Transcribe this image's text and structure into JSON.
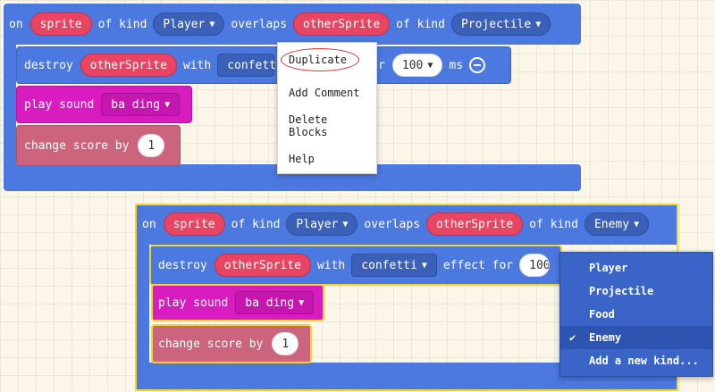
{
  "block1": {
    "on": "on",
    "sprite": "sprite",
    "of_kind": "of kind",
    "kind1": "Player",
    "overlaps": "overlaps",
    "other": "otherSprite",
    "of_kind2": "of kind",
    "kind2": "Projectile",
    "destroy": "destroy",
    "destroy_target": "otherSprite",
    "with": "with",
    "effect": "confett",
    "for_text": "or",
    "duration": "100",
    "ms": "ms",
    "play_sound": "play sound",
    "sound": "ba ding",
    "change_score": "change score by",
    "score": "1"
  },
  "context_menu": {
    "items": [
      "Duplicate",
      "Add Comment",
      "Delete Blocks",
      "Help"
    ]
  },
  "block2": {
    "on": "on",
    "sprite": "sprite",
    "of_kind": "of kind",
    "kind1": "Player",
    "overlaps": "overlaps",
    "other": "otherSprite",
    "of_kind2": "of kind",
    "kind2": "Enemy",
    "destroy": "destroy",
    "destroy_target": "otherSprite",
    "with": "with",
    "effect": "confetti",
    "effect_for": "effect for",
    "duration": "100",
    "play_sound": "play sound",
    "sound": "ba ding",
    "change_score": "change score by",
    "score": "1"
  },
  "kind_dropdown": {
    "items": [
      "Player",
      "Projectile",
      "Food",
      "Enemy",
      "Add a new kind..."
    ],
    "selected": "Enemy"
  },
  "icons": {
    "check": "check-icon",
    "caret": "caret-down-icon",
    "remove": "minus-circle-icon"
  },
  "colors": {
    "event": "#4b79e0",
    "variable": "#e94562",
    "music": "#d81cc0",
    "info": "#cd647e",
    "highlight": "#f2d62e"
  }
}
